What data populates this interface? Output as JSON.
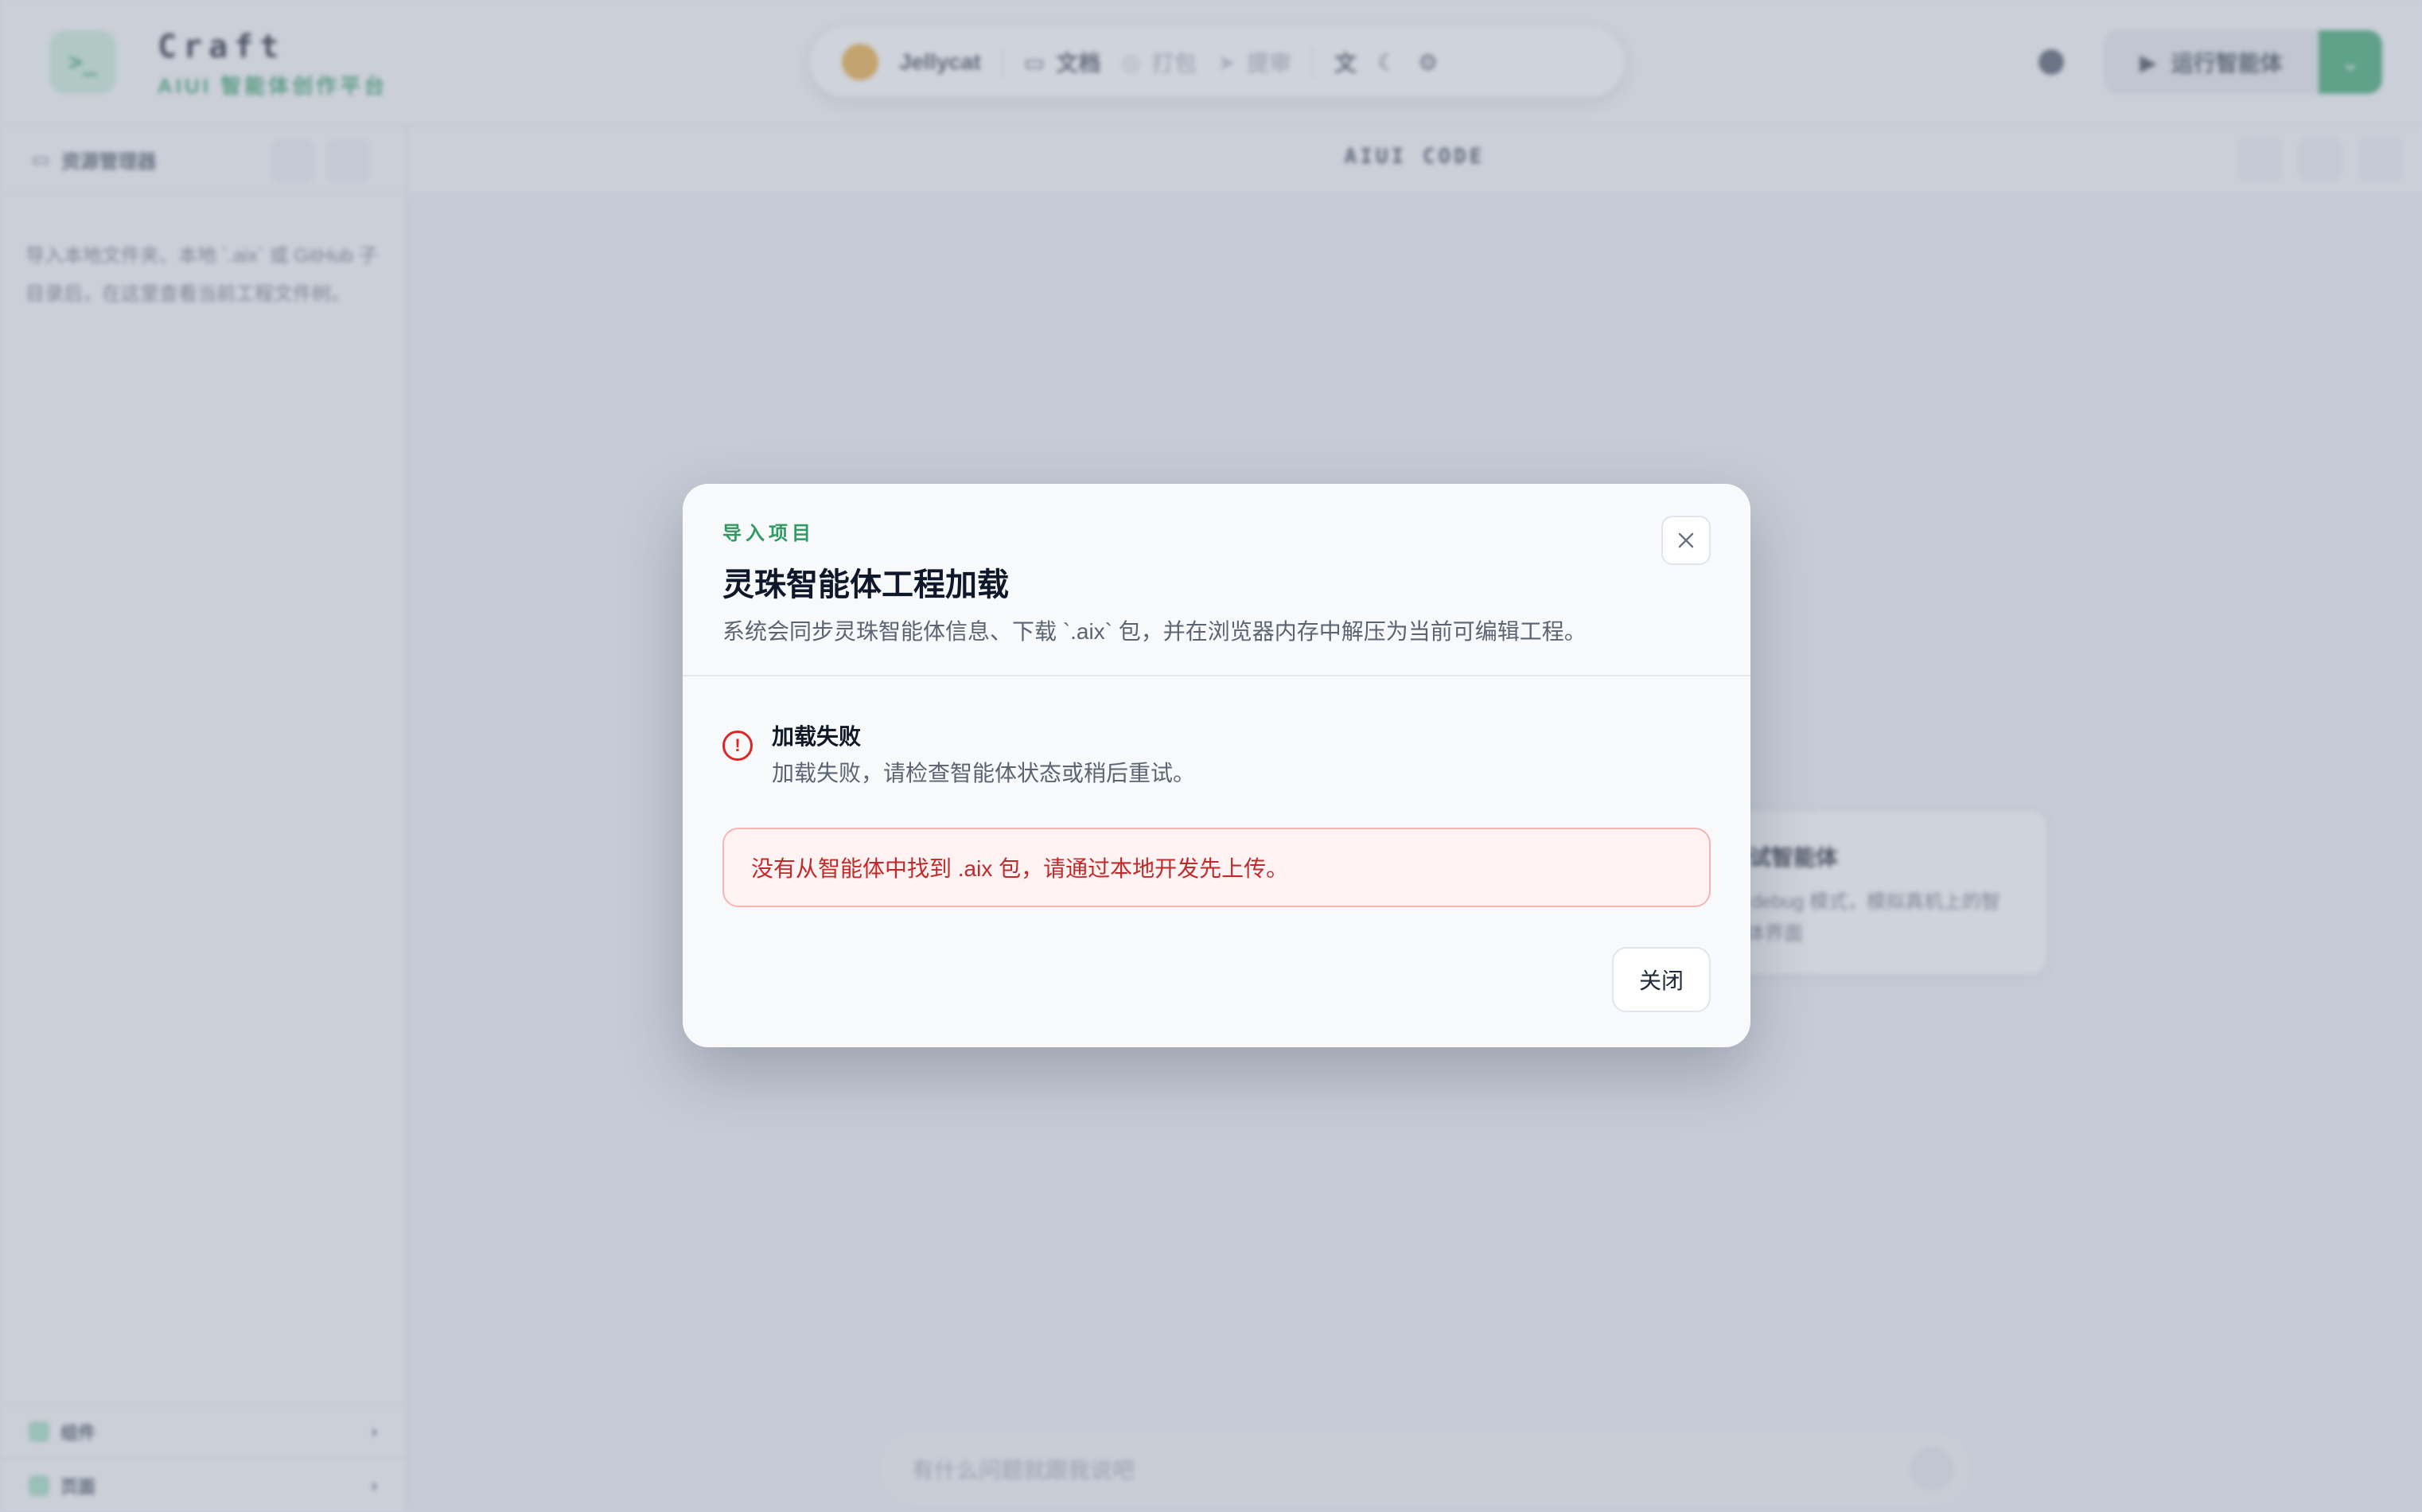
{
  "app": {
    "brand_title": "Craft",
    "brand_subtitle": "AIUI 智能体创作平台",
    "logo_glyph": ">_"
  },
  "nav": {
    "user_name": "Jellycat",
    "items": [
      {
        "label": "文档",
        "icon": "book-icon"
      },
      {
        "label": "打包",
        "icon": "package-icon"
      },
      {
        "label": "提审",
        "icon": "send-icon"
      }
    ],
    "tools": [
      "translate-icon",
      "moon-icon",
      "gear-icon"
    ]
  },
  "header_actions": {
    "run_label": "运行智能体"
  },
  "sidebar": {
    "title": "资源管理器",
    "empty_hint": "导入本地文件夹、本地 `.aix` 或 GitHub 子目录后，在这里查看当前工程文件树。",
    "footer_items": [
      {
        "label": "组件"
      },
      {
        "label": "页面"
      }
    ]
  },
  "main": {
    "title": "AIUI CODE",
    "card": {
      "title": "调试智能体",
      "desc": "以 debug 模式，模拟真机上的智能体界面"
    },
    "chat_placeholder": "有什么问题就跟我说吧"
  },
  "modal": {
    "eyebrow": "导入项目",
    "title": "灵珠智能体工程加载",
    "description": "系统会同步灵珠智能体信息、下载 `.aix` 包，并在浏览器内存中解压为当前可编辑工程。",
    "error_title": "加载失败",
    "error_desc": "加载失败，请检查智能体状态或稍后重试。",
    "error_detail": "没有从智能体中找到 .aix 包，请通过本地开发先上传。",
    "close_label": "关闭"
  },
  "colors": {
    "accent": "#2f9a63",
    "error": "#dc2626",
    "error_bg": "#fef2f2"
  }
}
